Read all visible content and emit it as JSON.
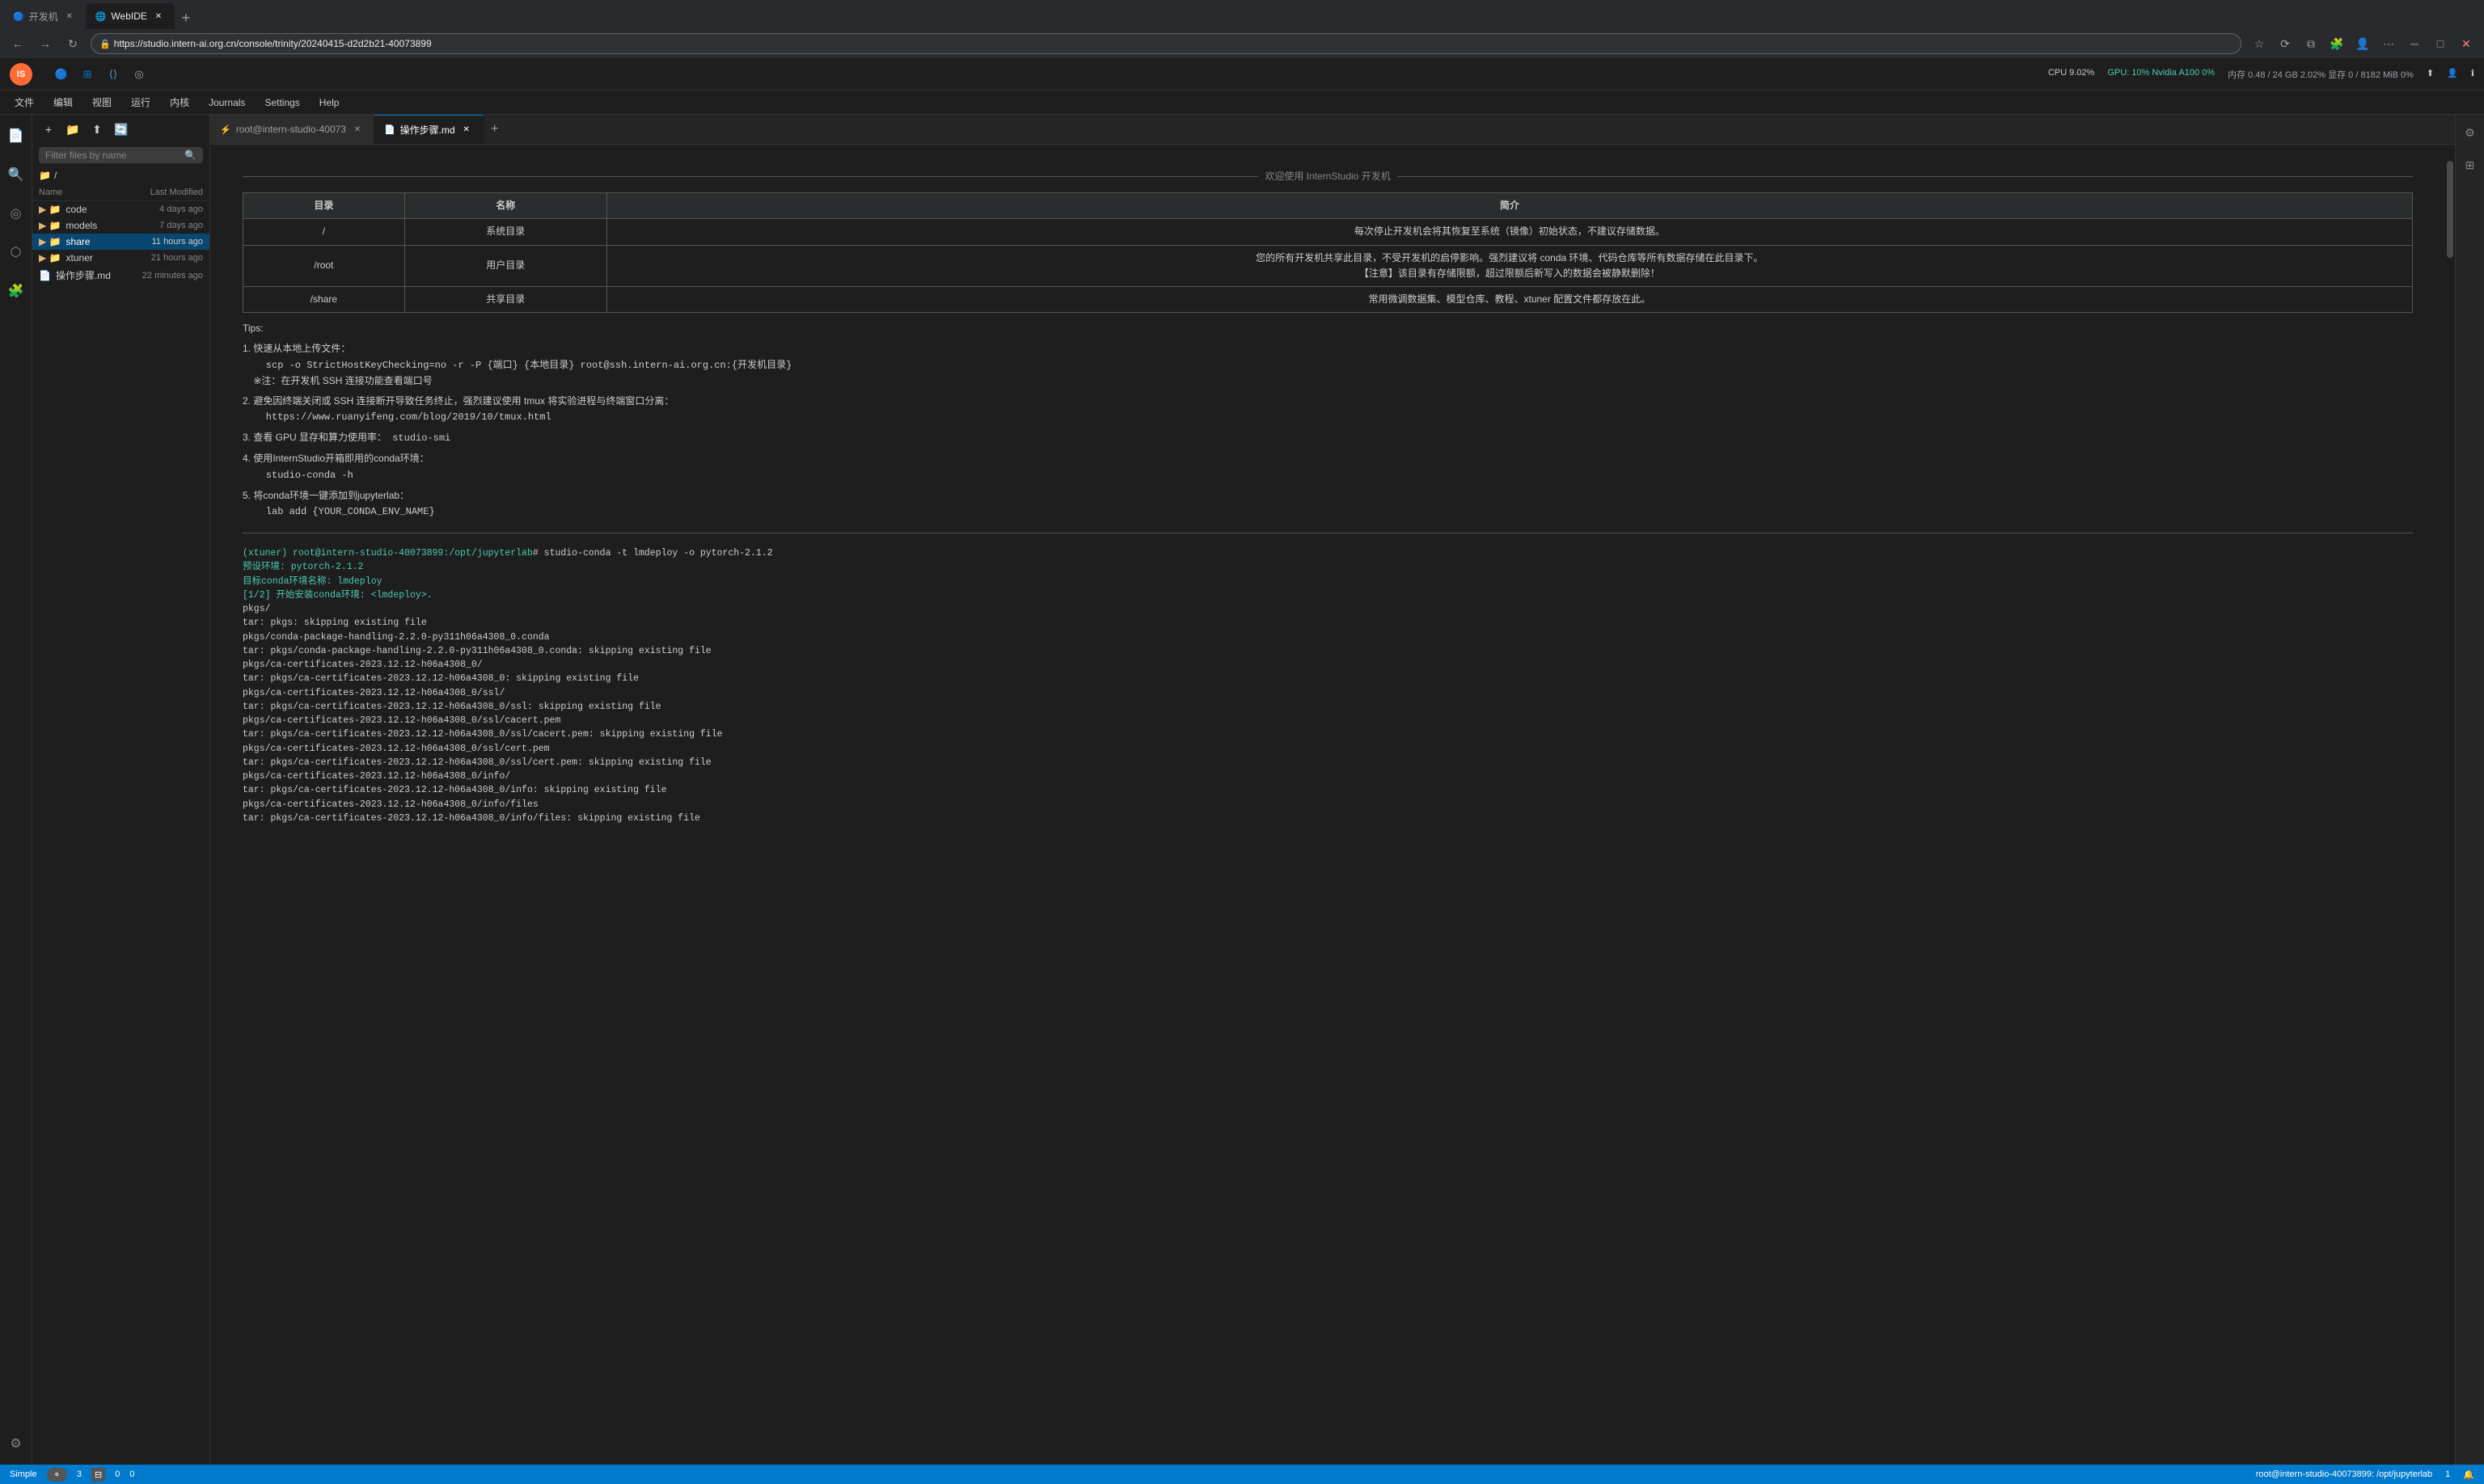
{
  "browser": {
    "address": "https://studio.intern-ai.org.cn/console/trinity/20240415-d2d2b21-40073899",
    "tabs": [
      {
        "id": "tab-devmachine",
        "label": "开发机",
        "icon": "🔵",
        "active": false
      },
      {
        "id": "tab-webide",
        "label": "WebIDE",
        "icon": "🌐",
        "active": true
      }
    ],
    "new_tab_label": "+"
  },
  "toolbar": {
    "logo_text": "IS",
    "system_info": {
      "cpu": "CPU  9.02%",
      "gpu": "GPU: 10% Nvidia A100  0%",
      "mem": "内存 0.48 / 24 GB  2.02%  显存 0 / 8182 MiB  0%"
    }
  },
  "menu": {
    "items": [
      "文件",
      "编辑",
      "视图",
      "运行",
      "内核",
      "Journals",
      "Settings",
      "Help"
    ]
  },
  "sidebar": {
    "filter_placeholder": "Filter files by name",
    "root_path": "/",
    "column_name": "Name",
    "column_modified": "Last Modified",
    "files": [
      {
        "type": "folder",
        "name": "code",
        "modified": "4 days ago"
      },
      {
        "type": "folder",
        "name": "models",
        "modified": "7 days ago"
      },
      {
        "type": "folder",
        "name": "share",
        "modified": "11 hours ago",
        "active": true
      },
      {
        "type": "folder",
        "name": "xtuner",
        "modified": "21 hours ago"
      },
      {
        "type": "file-md",
        "name": "操作步骤.md",
        "modified": "22 minutes ago"
      }
    ]
  },
  "editor": {
    "tabs": [
      {
        "id": "tab-terminal",
        "label": "root@intern-studio-40073",
        "icon": "⚡",
        "active": false
      },
      {
        "id": "tab-md",
        "label": "操作步骤.md",
        "icon": "📄",
        "active": true
      }
    ],
    "welcome": {
      "divider_text": "欢迎使用 InternStudio 开发机",
      "table": {
        "headers": [
          "目录",
          "名称",
          "简介"
        ],
        "rows": [
          [
            "/",
            "系统目录",
            "每次停止开发机会将其恢复至系统（镜像）初始状态，不建议存储数据。"
          ],
          [
            "/root",
            "用户目录",
            "您的所有开发机共享此目录，不受开发机的启停影响。强烈建议将 conda 环境、代码仓库等所有数据存储在此目录下。\n【注意】该目录有存储限额，超过限额后新写入的数据会被静默删除！"
          ],
          [
            "/share",
            "共享目录",
            "常用微调数据集、模型仓库、教程、xtuner 配置文件都存放在此。"
          ]
        ]
      },
      "tips_title": "Tips:",
      "tips": [
        {
          "num": "1.",
          "label": "快速从本地上传文件：",
          "code": "scp -o StrictHostKeyChecking=no -r -P {端口} {本地目录} root@ssh.intern-ai.org.cn:{开发机目录}",
          "note": "※注：在开发机 SSH 连接功能查看端口号"
        },
        {
          "num": "2.",
          "label": "避免因终端关闭或 SSH 连接断开导致任务终止，强烈建议使用 tmux 将实验进程与终端窗口分离：",
          "code": "https://www.ruanyifeng.com/blog/2019/10/tmux.html"
        },
        {
          "num": "3.",
          "label": "查看 GPU 显存和算力使用率：",
          "code": "studio-smi"
        },
        {
          "num": "4.",
          "label": "使用InternStudio开箱即用的conda环境：",
          "code": "studio-conda -h"
        },
        {
          "num": "5.",
          "label": "将conda环境一键添加到jupyterlab：",
          "code": "lab add {YOUR_CONDA_ENV_NAME}"
        }
      ]
    },
    "terminal": {
      "prompt": "(xtuner) root@intern-studio-40073899:/opt/jupyterlab#",
      "command": "studio-conda -t lmdeploy -o pytorch-2.1.2",
      "output_lines": [
        {
          "type": "green",
          "text": "预设环境: pytorch-2.1.2"
        },
        {
          "type": "green",
          "text": "目标conda环境名称: lmdeploy"
        },
        {
          "type": "green",
          "text": "[1/2] 开始安装conda环境: <lmdeploy>."
        },
        {
          "type": "normal",
          "text": "pkgs/"
        },
        {
          "type": "normal",
          "text": "tar: pkgs: skipping existing file"
        },
        {
          "type": "normal",
          "text": "pkgs/conda-package-handling-2.2.0-py311h06a4308_0.conda"
        },
        {
          "type": "normal",
          "text": "tar: pkgs/conda-package-handling-2.2.0-py311h06a4308_0.conda: skipping existing file"
        },
        {
          "type": "normal",
          "text": "pkgs/ca-certificates-2023.12.12-h06a4308_0/"
        },
        {
          "type": "normal",
          "text": "tar: pkgs/ca-certificates-2023.12.12-h06a4308_0: skipping existing file"
        },
        {
          "type": "normal",
          "text": "pkgs/ca-certificates-2023.12.12-h06a4308_0/ssl/"
        },
        {
          "type": "normal",
          "text": "tar: pkgs/ca-certificates-2023.12.12-h06a4308_0/ssl: skipping existing file"
        },
        {
          "type": "normal",
          "text": "pkgs/ca-certificates-2023.12.12-h06a4308_0/ssl/cacert.pem"
        },
        {
          "type": "normal",
          "text": "tar: pkgs/ca-certificates-2023.12.12-h06a4308_0/ssl/cacert.pem: skipping existing file"
        },
        {
          "type": "normal",
          "text": "pkgs/ca-certificates-2023.12.12-h06a4308_0/ssl/cert.pem"
        },
        {
          "type": "normal",
          "text": "tar: pkgs/ca-certificates-2023.12.12-h06a4308_0/ssl/cert.pem: skipping existing file"
        },
        {
          "type": "normal",
          "text": "pkgs/ca-certificates-2023.12.12-h06a4308_0/info/"
        },
        {
          "type": "normal",
          "text": "tar: pkgs/ca-certificates-2023.12.12-h06a4308_0/info: skipping existing file"
        },
        {
          "type": "normal",
          "text": "pkgs/ca-certificates-2023.12.12-h06a4308_0/info/files"
        },
        {
          "type": "normal",
          "text": "tar: pkgs/ca-certificates-2023.12.12-h06a4308_0/info/files: skipping existing file"
        }
      ]
    }
  },
  "status_bar": {
    "mode": "Simple",
    "toggle": false,
    "line_col": "3",
    "tab_size": "0",
    "encoding": "0",
    "server": "root@intern-studio-40073899: /opt/jupyterlab",
    "kernel_label": "1",
    "bell_icon": "🔔"
  },
  "icons": {
    "search": "🔍",
    "folder_new": "📁",
    "upload": "⬆",
    "refresh": "🔄",
    "chevron_down": "▼",
    "chevron_right": "▶",
    "gear": "⚙",
    "extensions": "🧩",
    "files": "📄",
    "debug": "🐛",
    "git": "🌿",
    "settings_icon": "⚙"
  }
}
